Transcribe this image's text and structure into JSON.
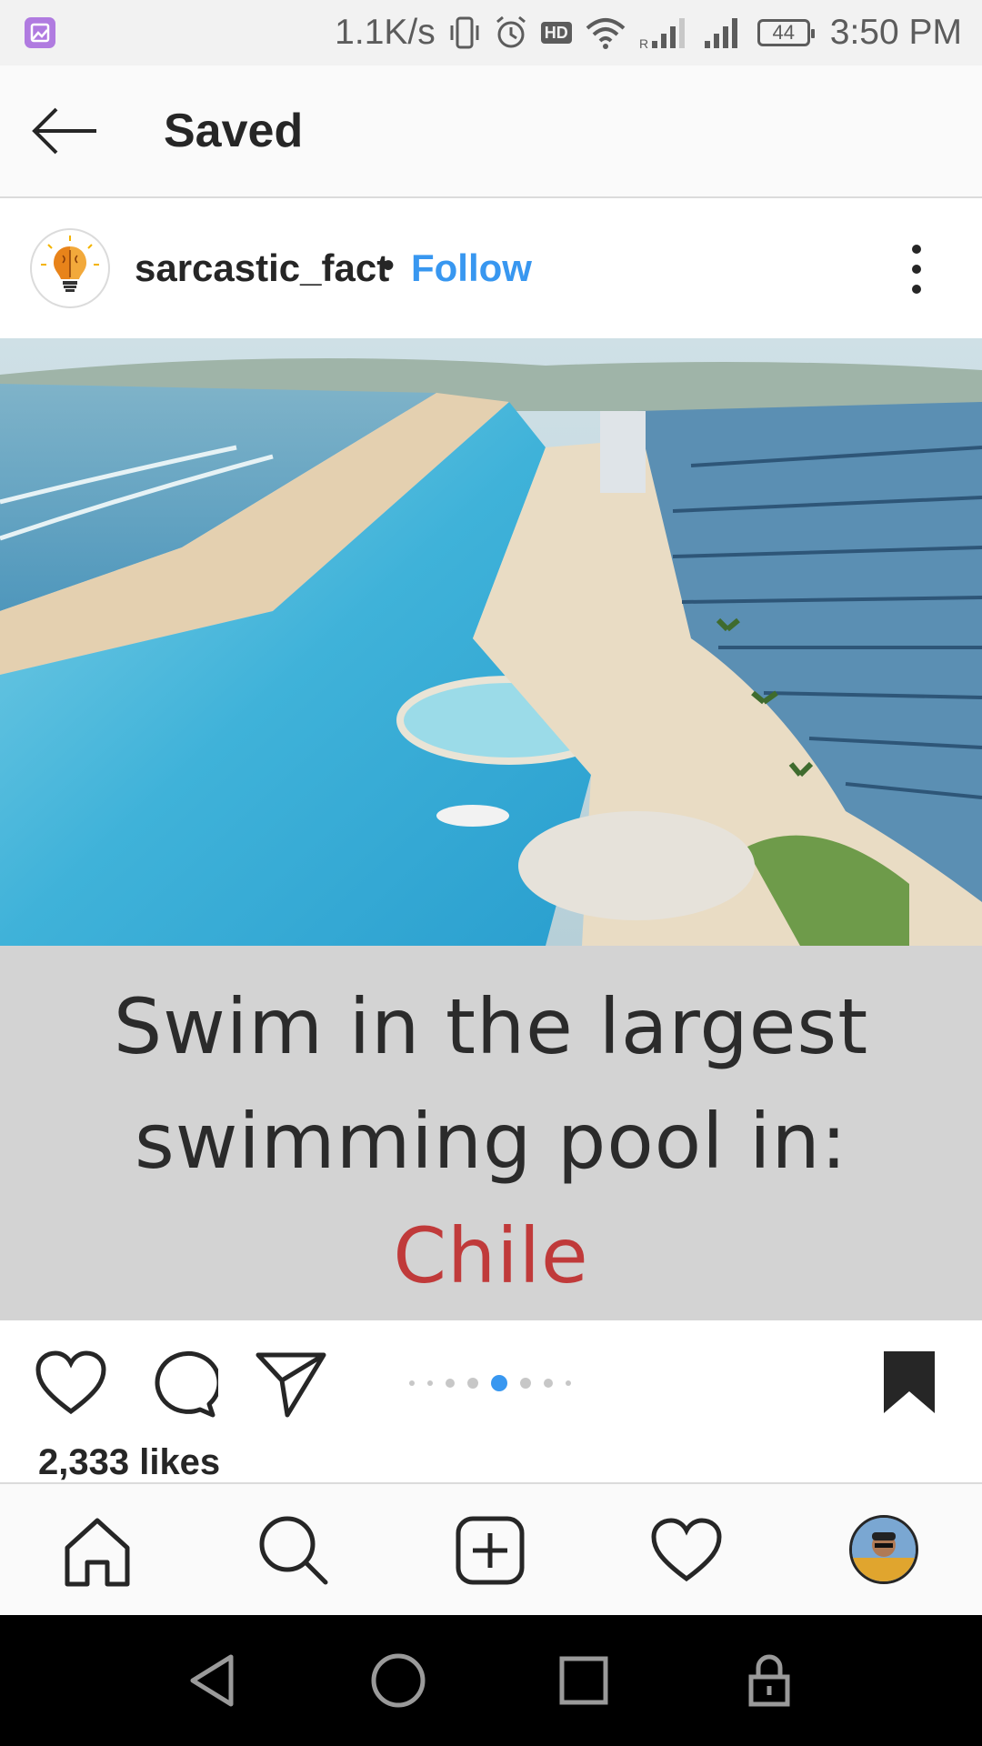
{
  "status_bar": {
    "net_speed": "1.1K/s",
    "battery": "44",
    "time": "3:50 PM",
    "hd_label": "HD",
    "icons": [
      "gallery-notification-icon",
      "vibrate-icon",
      "alarm-icon",
      "hd-icon",
      "wifi-icon",
      "signal-icon",
      "signal-icon",
      "battery-icon"
    ]
  },
  "header": {
    "title": "Saved",
    "back_icon": "arrow-left-icon"
  },
  "post": {
    "username": "sarcastic_fact",
    "separator": "•",
    "follow_label": "Follow",
    "more_icon": "more-vertical-icon",
    "caption_line1": "Swim in the largest",
    "caption_line2": "swimming pool in:",
    "caption_country": "Chile",
    "carousel": {
      "count": 8,
      "active_index": 4
    },
    "likes": "2,333 likes",
    "actions": [
      "heart-icon",
      "comment-icon",
      "share-icon",
      "bookmark-icon"
    ]
  },
  "bottom_nav": {
    "items": [
      "home-icon",
      "search-icon",
      "add-post-icon",
      "activity-heart-icon",
      "profile-avatar"
    ]
  },
  "system_nav": {
    "items": [
      "back-triangle-icon",
      "home-circle-icon",
      "recents-square-icon",
      "lock-icon"
    ]
  },
  "colors": {
    "accent": "#3897f0",
    "caption_highlight": "#c03a3a",
    "caption_panel": "#d3d3d3"
  }
}
